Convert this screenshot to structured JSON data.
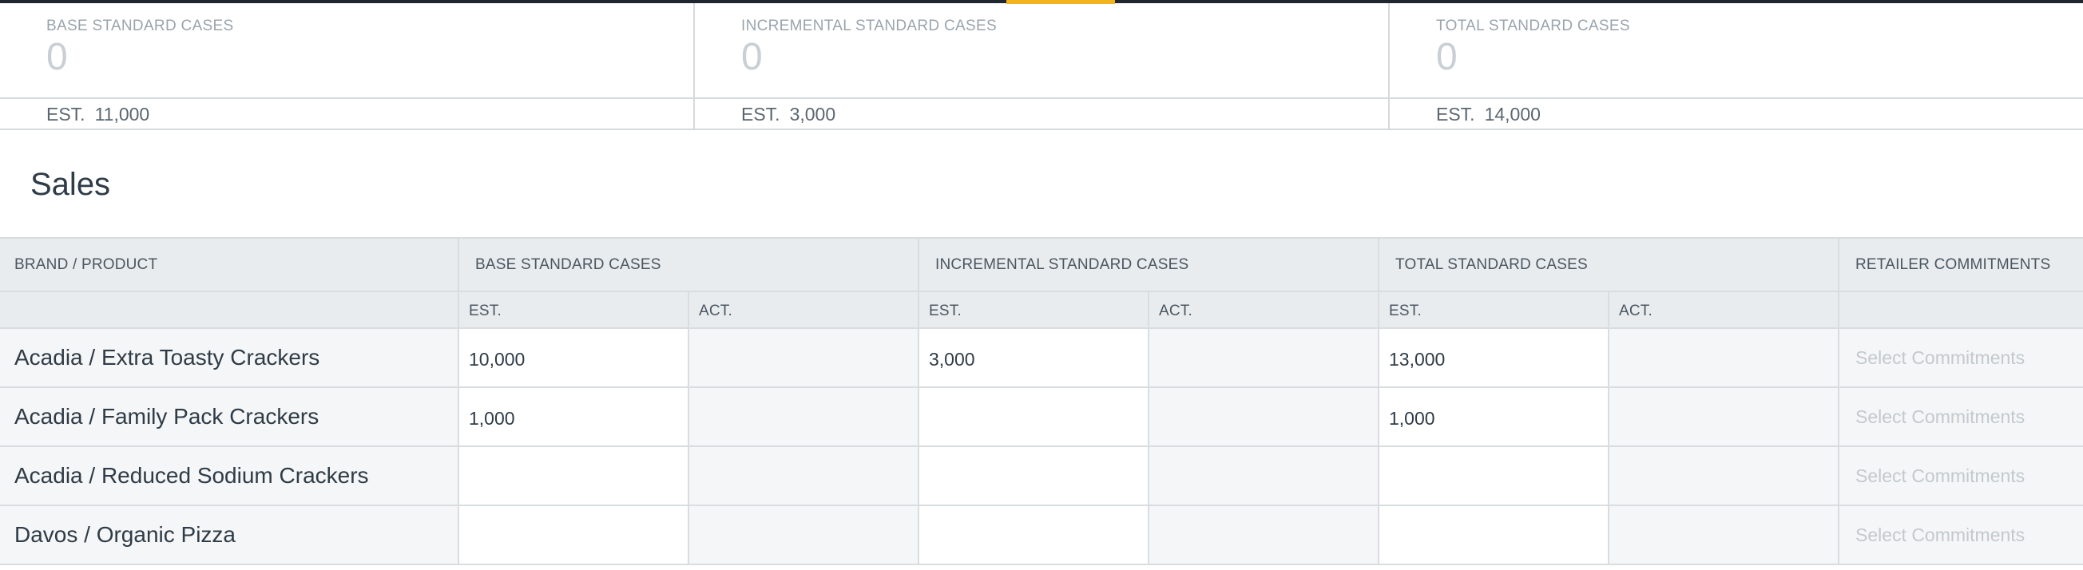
{
  "summary": {
    "cards": [
      {
        "label": "BASE STANDARD CASES",
        "value": "0",
        "est_label": "EST.",
        "est_value": "11,000"
      },
      {
        "label": "INCREMENTAL STANDARD CASES",
        "value": "0",
        "est_label": "EST.",
        "est_value": "3,000"
      },
      {
        "label": "TOTAL STANDARD CASES",
        "value": "0",
        "est_label": "EST.",
        "est_value": "14,000"
      }
    ]
  },
  "section": {
    "title": "Sales"
  },
  "table": {
    "headers": {
      "brand": "BRAND / PRODUCT",
      "base": "BASE STANDARD CASES",
      "incremental": "INCREMENTAL STANDARD CASES",
      "total": "TOTAL STANDARD CASES",
      "retailer": "RETAILER COMMITMENTS"
    },
    "subheaders": {
      "est": "EST.",
      "act": "ACT."
    },
    "rows": [
      {
        "brand": "Acadia / Extra Toasty Crackers",
        "base_est": "10,000",
        "base_act": "",
        "inc_est": "3,000",
        "inc_act": "",
        "total_est": "13,000",
        "total_act": "",
        "commitment_placeholder": "Select Commitments"
      },
      {
        "brand": "Acadia / Family Pack Crackers",
        "base_est": "1,000",
        "base_act": "",
        "inc_est": "",
        "inc_act": "",
        "total_est": "1,000",
        "total_act": "",
        "commitment_placeholder": "Select Commitments"
      },
      {
        "brand": "Acadia / Reduced Sodium Crackers",
        "base_est": "",
        "base_act": "",
        "inc_est": "",
        "inc_act": "",
        "total_est": "",
        "total_act": "",
        "commitment_placeholder": "Select Commitments"
      },
      {
        "brand": "Davos / Organic Pizza",
        "base_est": "",
        "base_act": "",
        "inc_est": "",
        "inc_act": "",
        "total_est": "",
        "total_act": "",
        "commitment_placeholder": "Select Commitments"
      }
    ]
  },
  "colors": {
    "accent": "#f2b321",
    "topbar": "#1f262d",
    "header_bg": "#e9ecee",
    "muted_text": "#9aa4ad"
  }
}
